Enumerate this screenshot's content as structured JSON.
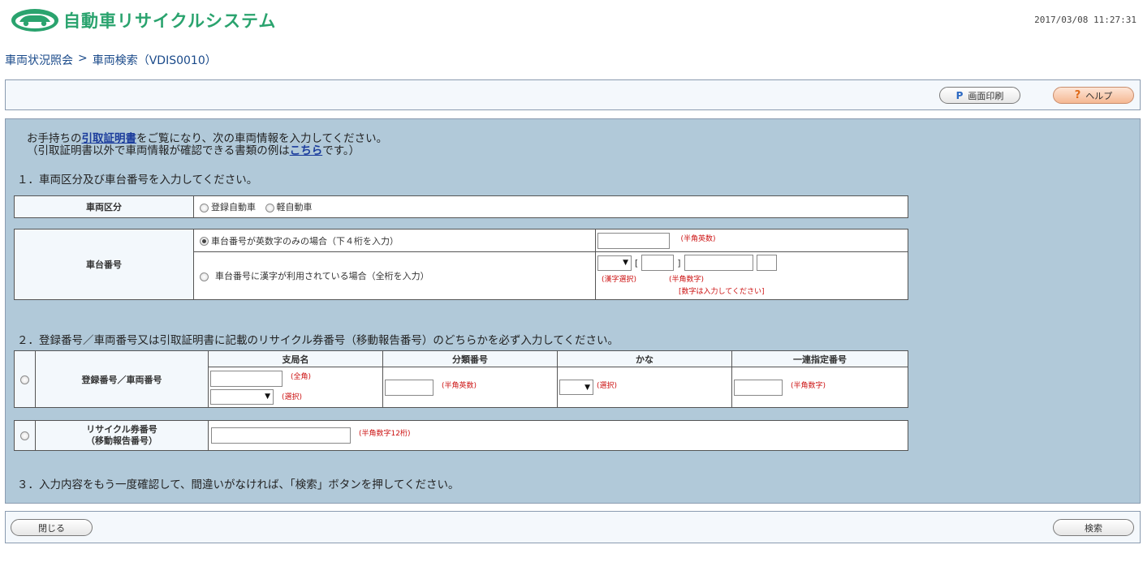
{
  "header": {
    "app_title": "自動車リサイクルシステム",
    "datetime": "2017/03/08 11:27:31"
  },
  "breadcrumb": {
    "parent": "車両状況照会",
    "separator": ">",
    "current": "車両検索（VDIS0010）"
  },
  "toolbar": {
    "print_label": "画面印刷",
    "help_label": "ヘルプ"
  },
  "intro": {
    "line1_pre": "お手持ちの",
    "line1_link": "引取証明書",
    "line1_post": "をご覧になり、次の車両情報を入力してください。",
    "line2_pre": "（引取証明書以外で車両情報が確認できる書類の例は",
    "line2_link": "こちら",
    "line2_post": "です。）"
  },
  "step1": "１．車両区分及び車台番号を入力してください。",
  "vehicle_class": {
    "label": "車両区分",
    "options": [
      "登録自動車",
      "軽自動車"
    ]
  },
  "chassis": {
    "label": "車台番号",
    "option_alnum": "車台番号が英数字のみの場合（下４桁を入力）",
    "option_kanji": "車台番号に漢字が利用されている場合（全桁を入力）",
    "hint_alnum": "(半角英数)",
    "hint_kanji_select": "(漢字選択)",
    "hint_halfwidth_num": "(半角数字)",
    "hint_no_number": "[数字は入力してください]",
    "bracket_open": "[",
    "bracket_close": "]"
  },
  "step2": "２．登録番号／車両番号又は引取証明書に記載のリサイクル券番号（移動報告番号）のどちらかを必ず入力してください。",
  "registration": {
    "label": "登録番号／車両番号",
    "columns": [
      "支局名",
      "分類番号",
      "かな",
      "一連指定番号"
    ],
    "hint_fullwidth": "(全角)",
    "hint_select": "(選択)",
    "hint_alnum": "(半角英数)",
    "hint_kana_select": "(選択)",
    "hint_num": "(半角数字)"
  },
  "recycle": {
    "label_line1": "リサイクル券番号",
    "label_line2": "（移動報告番号）",
    "hint": "(半角数字12桁)"
  },
  "step3": "３．入力内容をもう一度確認して、間違いがなければ、「検索」ボタンを押してください。",
  "footer": {
    "close_label": "閉じる",
    "search_label": "検索"
  },
  "colors": {
    "brand_green": "#2aa36e",
    "panel_blue": "#b1c9d9",
    "hint_red": "#cc1111",
    "link_blue": "#1b3c9c"
  }
}
